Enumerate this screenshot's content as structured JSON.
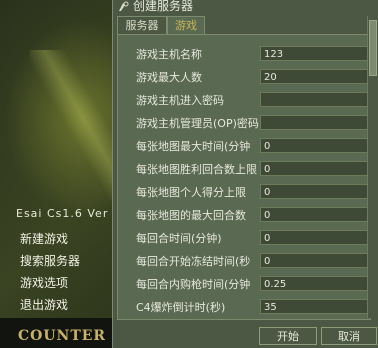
{
  "background_menu": {
    "version_text": "Esai Cs1.6 Ver",
    "items": [
      "新建游戏",
      "搜索服务器",
      "游戏选项",
      "退出游戏"
    ],
    "logo_text": "COUNTER"
  },
  "dialog": {
    "title": "创建服务器",
    "tabs": [
      {
        "label": "服务器",
        "active": false
      },
      {
        "label": "游戏",
        "active": true
      }
    ],
    "fields": [
      {
        "label": "游戏主机名称",
        "value": "123"
      },
      {
        "label": "游戏最大人数",
        "value": "20"
      },
      {
        "label": "游戏主机进入密码",
        "value": ""
      },
      {
        "label": "游戏主机管理员(OP)密码",
        "value": ""
      },
      {
        "label": "每张地图最大时间(分钟",
        "value": "0"
      },
      {
        "label": "每张地图胜利回合数上限",
        "value": "0"
      },
      {
        "label": "每张地图个人得分上限",
        "value": "0"
      },
      {
        "label": "每张地图的最大回合数",
        "value": "0"
      },
      {
        "label": "每回合时间(分钟)",
        "value": "0"
      },
      {
        "label": "每回合开始冻结时间(秒",
        "value": "0"
      },
      {
        "label": "每回合内购枪时间(分钟",
        "value": "0.25"
      },
      {
        "label": "C4爆炸倒计时(秒)",
        "value": "35"
      }
    ],
    "buttons": {
      "start": "开始",
      "cancel": "取消"
    }
  },
  "colors": {
    "tab_active_text": "#c9b458",
    "panel": "#5a6a52",
    "dialog": "#4c5844"
  }
}
